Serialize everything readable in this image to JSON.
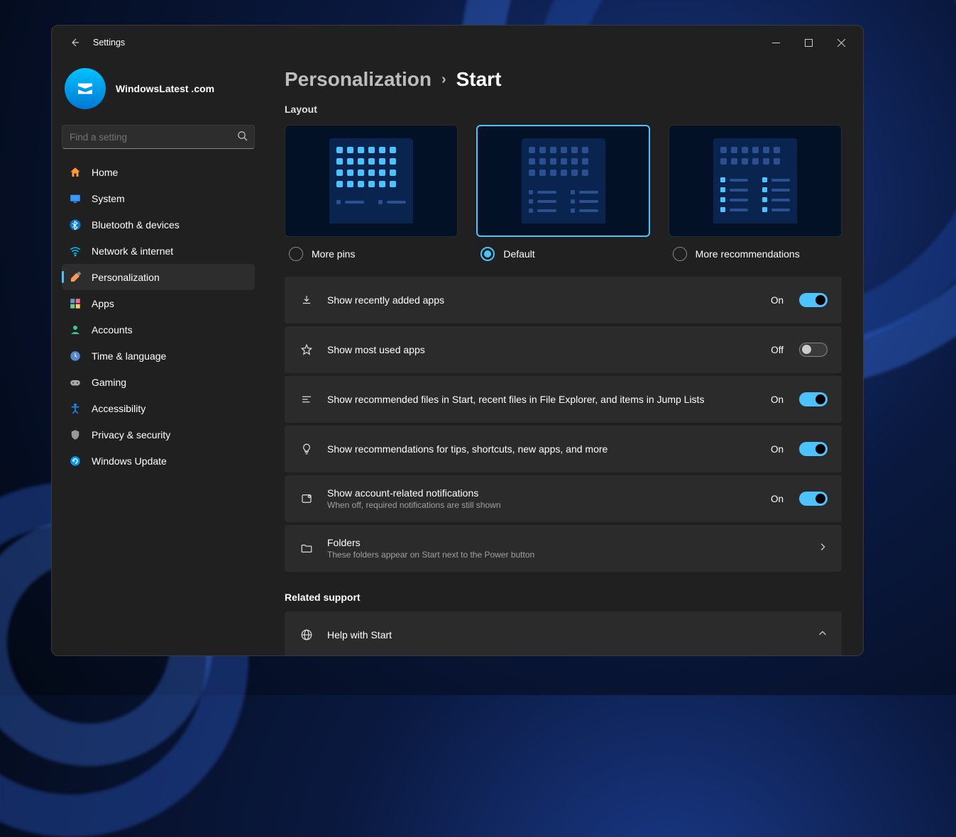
{
  "window": {
    "title": "Settings"
  },
  "profile": {
    "name": "WindowsLatest .com"
  },
  "search": {
    "placeholder": "Find a setting"
  },
  "nav": {
    "home": "Home",
    "system": "System",
    "bluetooth": "Bluetooth & devices",
    "network": "Network & internet",
    "personalization": "Personalization",
    "apps": "Apps",
    "accounts": "Accounts",
    "time": "Time & language",
    "gaming": "Gaming",
    "accessibility": "Accessibility",
    "privacy": "Privacy & security",
    "update": "Windows Update"
  },
  "breadcrumb": {
    "parent": "Personalization",
    "current": "Start"
  },
  "layout": {
    "label": "Layout",
    "more_pins": "More pins",
    "default": "Default",
    "more_recs": "More recommendations"
  },
  "settings": {
    "recently_added": {
      "title": "Show recently added apps",
      "state": "On"
    },
    "most_used": {
      "title": "Show most used apps",
      "state": "Off"
    },
    "recommended_files": {
      "title": "Show recommended files in Start, recent files in File Explorer, and items in Jump Lists",
      "state": "On"
    },
    "tips": {
      "title": "Show recommendations for tips, shortcuts, new apps, and more",
      "state": "On"
    },
    "account_notif": {
      "title": "Show account-related notifications",
      "desc": "When off, required notifications are still shown",
      "state": "On"
    },
    "folders": {
      "title": "Folders",
      "desc": "These folders appear on Start next to the Power button"
    }
  },
  "related": {
    "heading": "Related support",
    "help": "Help with Start"
  }
}
